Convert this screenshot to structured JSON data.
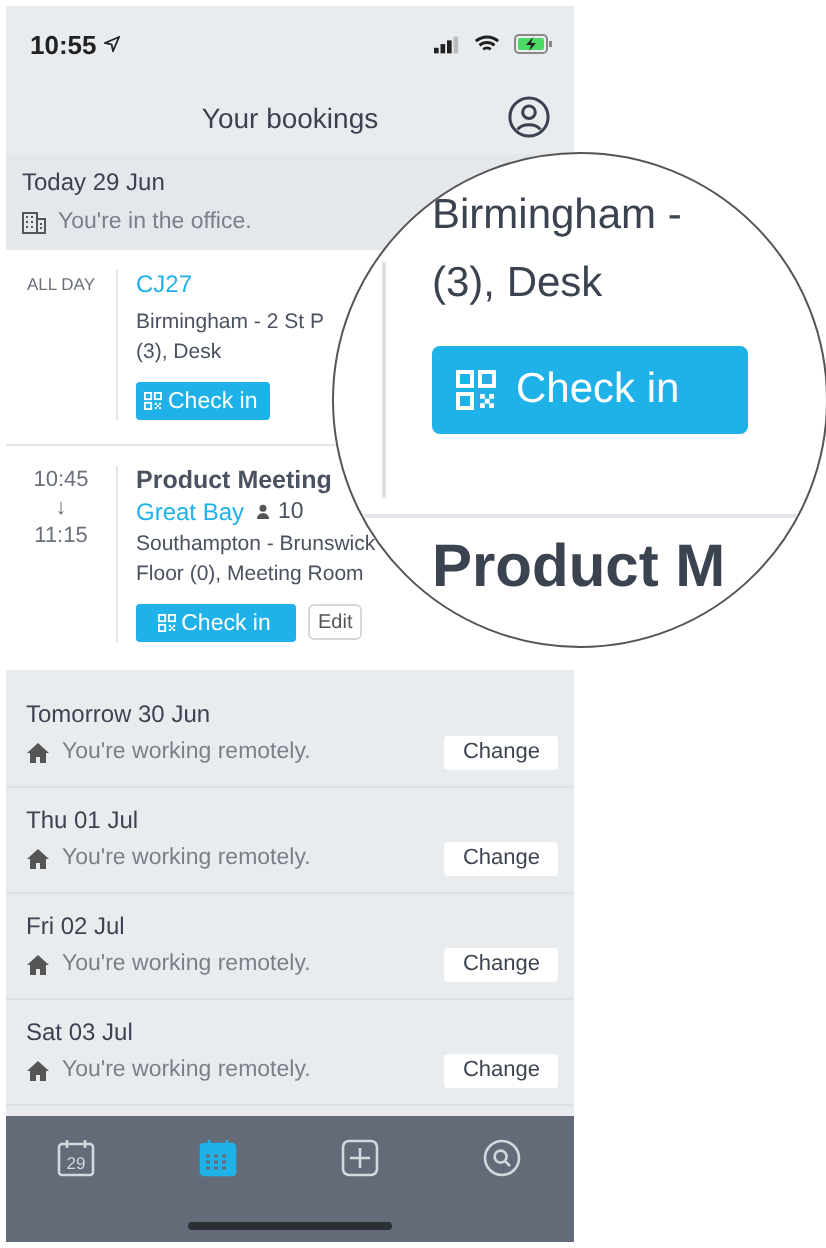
{
  "status_bar": {
    "time": "10:55"
  },
  "header": {
    "title": "Your bookings"
  },
  "today": {
    "date": "Today 29 Jun",
    "status": "You're in the office.",
    "kind": "office"
  },
  "bookings": [
    {
      "kind": "desk",
      "time": [
        "ALL DAY"
      ],
      "title": "CJ27",
      "address": [
        "Birmingham - 2 St P",
        "(3), Desk"
      ],
      "actions": [
        "Check in"
      ]
    },
    {
      "kind": "meeting",
      "time": [
        "10:45",
        "↓",
        "11:15"
      ],
      "title": "Product Meeting",
      "room": "Great Bay",
      "capacity": "10",
      "address": [
        "Southampton - Brunswick",
        "Floor (0), Meeting Room"
      ],
      "actions": [
        "Check in",
        "Edit"
      ]
    }
  ],
  "days": [
    {
      "date": "Tomorrow 30 Jun",
      "status": "You're working remotely.",
      "kind": "remote",
      "action": "Change"
    },
    {
      "date": "Thu 01 Jul",
      "status": "You're working remotely.",
      "kind": "remote",
      "action": "Change"
    },
    {
      "date": "Fri 02 Jul",
      "status": "You're working remotely.",
      "kind": "remote",
      "action": "Change"
    },
    {
      "date": "Sat 03 Jul",
      "status": "You're working remotely.",
      "kind": "remote",
      "action": "Change"
    }
  ],
  "tab_bar": [
    {
      "kind": "day",
      "label": "29",
      "selected": false
    },
    {
      "kind": "calendar",
      "selected": true
    },
    {
      "kind": "add",
      "selected": false
    },
    {
      "kind": "search",
      "selected": false
    }
  ],
  "magnifier": {
    "lines": [
      "Birmingham -",
      "(3), Desk"
    ],
    "button": "Check in",
    "next_title": "Product M"
  }
}
